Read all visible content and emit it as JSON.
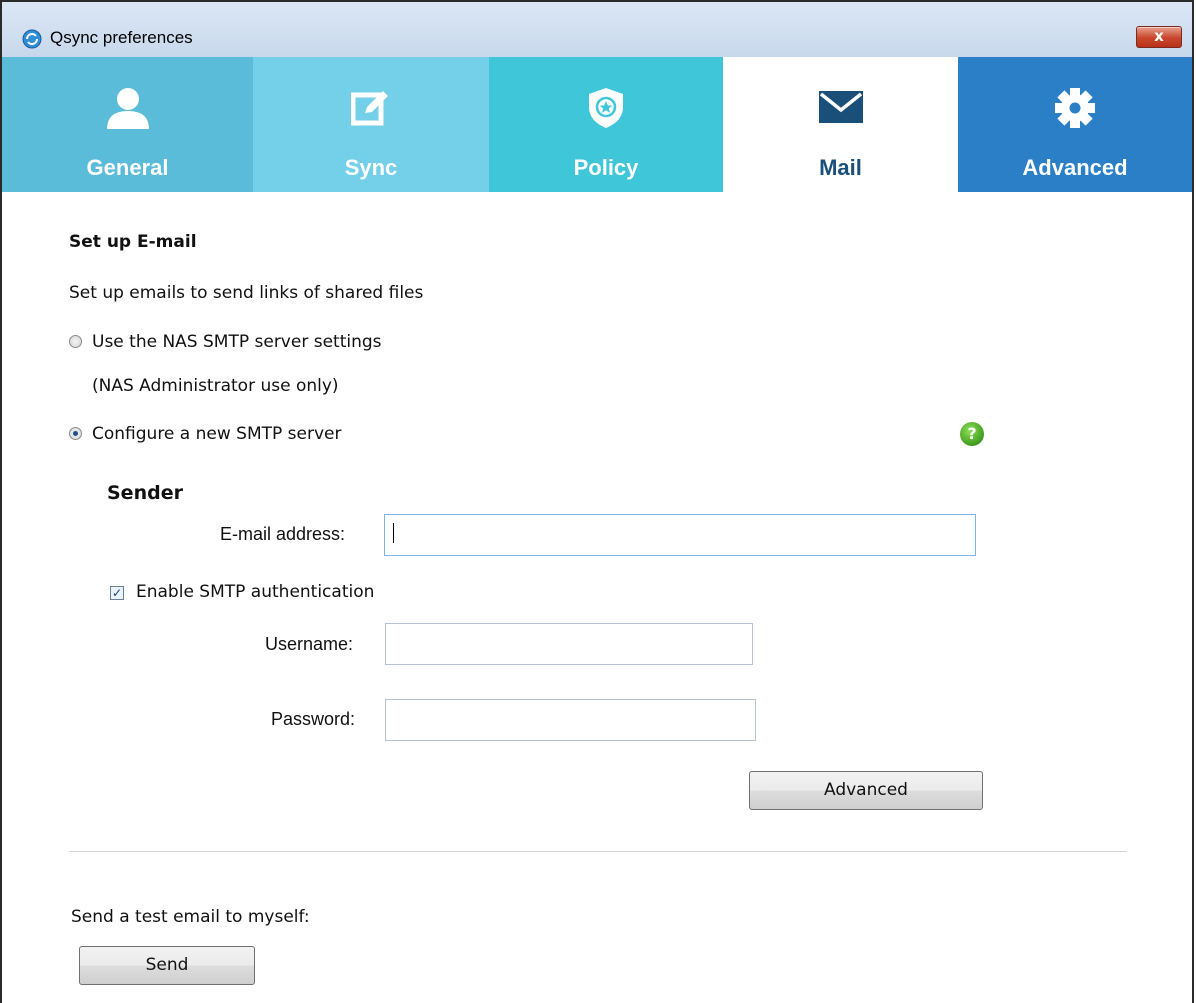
{
  "window": {
    "title": "Qsync preferences",
    "close_glyph": "x"
  },
  "tabs": [
    {
      "label": "General",
      "icon": "user-icon"
    },
    {
      "label": "Sync",
      "icon": "edit-icon"
    },
    {
      "label": "Policy",
      "icon": "shield-icon"
    },
    {
      "label": "Mail",
      "icon": "envelope-icon",
      "selected": true
    },
    {
      "label": "Advanced",
      "icon": "gear-icon"
    }
  ],
  "mail": {
    "heading": "Set up E-mail",
    "description": "Set up emails to send links of shared files",
    "option_nas": {
      "label": "Use the NAS SMTP server settings",
      "note": "(NAS Administrator use only)",
      "checked": false
    },
    "option_new": {
      "label": "Configure a new SMTP server",
      "checked": true
    },
    "help_glyph": "?",
    "sender": {
      "heading": "Sender",
      "email_label": "E-mail address:",
      "email_value": ""
    },
    "smtp_auth": {
      "label": "Enable SMTP authentication",
      "checked": true,
      "check_glyph": "✓",
      "username_label": "Username:",
      "username_value": "",
      "password_label": "Password:",
      "password_value": ""
    },
    "advanced_button": "Advanced",
    "test": {
      "label": "Send a test email to myself:",
      "send_button": "Send"
    }
  },
  "colors": {
    "tab_general": "#5bbcd9",
    "tab_sync": "#74cfe8",
    "tab_policy": "#3fc6d8",
    "tab_mail": "#ffffff",
    "tab_advanced": "#2a7fc6"
  }
}
